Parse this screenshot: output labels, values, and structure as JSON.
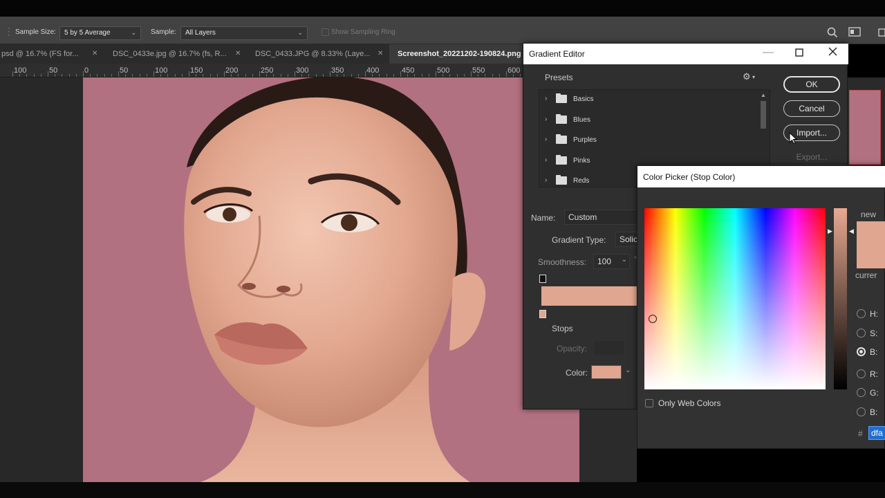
{
  "colors": {
    "stop_color": "#e1a68f",
    "photo_bg": "#b27180"
  },
  "options_bar": {
    "sample_size_label": "Sample Size:",
    "sample_size_value": "5 by 5 Average",
    "sample_label": "Sample:",
    "sample_value": "All Layers",
    "show_sampling_ring": "Show Sampling Ring"
  },
  "tabs": [
    {
      "label": "psd @ 16.7% (FS for..."
    },
    {
      "label": "DSC_0433e.jpg @ 16.7% (fs, R..."
    },
    {
      "label": "DSC_0433.JPG @ 8.33% (Laye..."
    },
    {
      "label": "Screenshot_20221202-190824.png"
    }
  ],
  "ruler": [
    "100",
    "50",
    "0",
    "50",
    "100",
    "150",
    "200",
    "250",
    "300",
    "350",
    "400",
    "450",
    "500",
    "550",
    "600"
  ],
  "gradient_editor": {
    "title": "Gradient Editor",
    "presets_label": "Presets",
    "presets": [
      {
        "label": "Basics"
      },
      {
        "label": "Blues"
      },
      {
        "label": "Purples"
      },
      {
        "label": "Pinks"
      },
      {
        "label": "Reds"
      }
    ],
    "ok": "OK",
    "cancel": "Cancel",
    "import": "Import...",
    "export": "Export...",
    "name_label": "Name:",
    "name_value": "Custom",
    "gradient_type_label": "Gradient Type:",
    "gradient_type_value": "Solic",
    "smoothness_label": "Smoothness:",
    "smoothness_value": "100",
    "stops_label": "Stops",
    "opacity_label": "Opacity:",
    "color_label": "Color:"
  },
  "color_picker": {
    "title": "Color Picker (Stop Color)",
    "new_label": "new",
    "current_label": "currer",
    "only_web_colors": "Only Web Colors",
    "fields": [
      {
        "label": "H:"
      },
      {
        "label": "S:"
      },
      {
        "label": "B:"
      },
      {
        "label": "R:"
      },
      {
        "label": "G:"
      },
      {
        "label": "B:"
      }
    ],
    "hash": "#",
    "hex_value": "dfa"
  }
}
